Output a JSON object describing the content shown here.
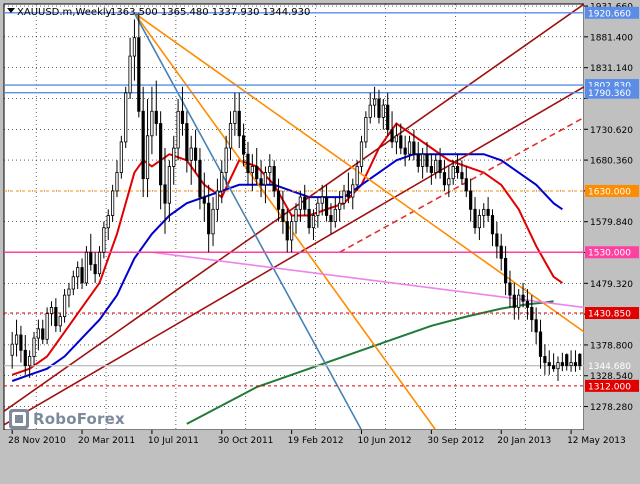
{
  "chart_header": {
    "symbol": "XAUUSD.m,Weekly",
    "ohlc": "1363.500 1365.480 1337.930 1344.930"
  },
  "brand": {
    "name": "RoboForex"
  },
  "colors": {
    "plot_bg": "#ffffff",
    "frame_bg": "#c0c0c0",
    "grid": "#000000",
    "candle": "#000000",
    "ma_short": "#e00000",
    "ma_mid": "#0000d0",
    "ma_long": "#227a3a",
    "level_blue": "#5b8de8",
    "level_pink": "#ff40a0",
    "level_red": "#e00000",
    "level_orange": "#ff8c00",
    "trend_darkred": "#a01010",
    "trend_orange": "#ff8c00",
    "trend_steel": "#4682b4",
    "trend_violet": "#ee82ee"
  },
  "chart_data": {
    "type": "candlestick",
    "timeframe": "Weekly",
    "ylim": [
      1240,
      1935
    ],
    "y_ticks": [
      1931.66,
      1881.4,
      1831.14,
      1780.88,
      1730.62,
      1680.36,
      1630.1,
      1579.84,
      1529.58,
      1479.32,
      1429.06,
      1378.8,
      1328.54,
      1278.28
    ],
    "y_tick_labels": [
      "1931.660",
      "1881.400",
      "1831.140",
      "1730.620",
      "1680.360",
      "1579.840",
      "1479.320",
      "1378.800",
      "1328.540",
      "1278.280"
    ],
    "x_labels": [
      "28 Nov 2010",
      "20 Mar 2011",
      "10 Jul 2011",
      "30 Oct 2011",
      "19 Feb 2012",
      "10 Jun 2012",
      "30 Sep 2012",
      "20 Jan 2013",
      "12 May 2013"
    ],
    "x_label_index": [
      0,
      16,
      32,
      48,
      64,
      80,
      96,
      112,
      128
    ],
    "bars": 131,
    "ohlc": [
      [
        1362,
        1400,
        1340,
        1380
      ],
      [
        1380,
        1420,
        1360,
        1395
      ],
      [
        1395,
        1410,
        1350,
        1370
      ],
      [
        1370,
        1395,
        1330,
        1345
      ],
      [
        1345,
        1370,
        1325,
        1360
      ],
      [
        1360,
        1400,
        1345,
        1390
      ],
      [
        1390,
        1420,
        1370,
        1405
      ],
      [
        1405,
        1420,
        1380,
        1388
      ],
      [
        1388,
        1440,
        1380,
        1430
      ],
      [
        1430,
        1450,
        1410,
        1440
      ],
      [
        1440,
        1455,
        1400,
        1410
      ],
      [
        1410,
        1430,
        1400,
        1425
      ],
      [
        1425,
        1470,
        1415,
        1460
      ],
      [
        1460,
        1480,
        1440,
        1470
      ],
      [
        1470,
        1500,
        1460,
        1490
      ],
      [
        1490,
        1515,
        1470,
        1505
      ],
      [
        1505,
        1520,
        1470,
        1480
      ],
      [
        1480,
        1540,
        1475,
        1530
      ],
      [
        1530,
        1560,
        1500,
        1510
      ],
      [
        1510,
        1530,
        1480,
        1495
      ],
      [
        1495,
        1540,
        1490,
        1530
      ],
      [
        1530,
        1580,
        1520,
        1570
      ],
      [
        1570,
        1600,
        1550,
        1590
      ],
      [
        1590,
        1640,
        1580,
        1630
      ],
      [
        1630,
        1680,
        1620,
        1660
      ],
      [
        1660,
        1720,
        1650,
        1710
      ],
      [
        1710,
        1800,
        1700,
        1790
      ],
      [
        1790,
        1880,
        1780,
        1850
      ],
      [
        1850,
        1910,
        1810,
        1880
      ],
      [
        1880,
        1920,
        1750,
        1760
      ],
      [
        1760,
        1800,
        1620,
        1650
      ],
      [
        1650,
        1780,
        1620,
        1720
      ],
      [
        1720,
        1800,
        1690,
        1760
      ],
      [
        1760,
        1810,
        1720,
        1740
      ],
      [
        1740,
        1760,
        1600,
        1640
      ],
      [
        1640,
        1700,
        1560,
        1610
      ],
      [
        1610,
        1680,
        1580,
        1670
      ],
      [
        1670,
        1720,
        1640,
        1700
      ],
      [
        1700,
        1780,
        1680,
        1760
      ],
      [
        1760,
        1800,
        1720,
        1740
      ],
      [
        1740,
        1760,
        1660,
        1680
      ],
      [
        1680,
        1720,
        1640,
        1700
      ],
      [
        1700,
        1730,
        1660,
        1680
      ],
      [
        1680,
        1700,
        1600,
        1620
      ],
      [
        1620,
        1660,
        1580,
        1610
      ],
      [
        1610,
        1640,
        1530,
        1560
      ],
      [
        1560,
        1620,
        1540,
        1600
      ],
      [
        1600,
        1650,
        1580,
        1630
      ],
      [
        1630,
        1680,
        1610,
        1660
      ],
      [
        1660,
        1720,
        1640,
        1700
      ],
      [
        1700,
        1760,
        1680,
        1740
      ],
      [
        1740,
        1790,
        1720,
        1760
      ],
      [
        1760,
        1790,
        1700,
        1720
      ],
      [
        1720,
        1740,
        1670,
        1690
      ],
      [
        1690,
        1710,
        1640,
        1660
      ],
      [
        1660,
        1690,
        1630,
        1670
      ],
      [
        1670,
        1700,
        1640,
        1650
      ],
      [
        1650,
        1680,
        1620,
        1640
      ],
      [
        1640,
        1670,
        1610,
        1660
      ],
      [
        1660,
        1690,
        1640,
        1670
      ],
      [
        1670,
        1680,
        1620,
        1630
      ],
      [
        1630,
        1650,
        1580,
        1600
      ],
      [
        1600,
        1630,
        1560,
        1580
      ],
      [
        1580,
        1600,
        1530,
        1550
      ],
      [
        1550,
        1590,
        1530,
        1580
      ],
      [
        1580,
        1610,
        1560,
        1600
      ],
      [
        1600,
        1630,
        1580,
        1620
      ],
      [
        1620,
        1640,
        1590,
        1600
      ],
      [
        1600,
        1620,
        1560,
        1570
      ],
      [
        1570,
        1600,
        1550,
        1590
      ],
      [
        1590,
        1620,
        1570,
        1610
      ],
      [
        1610,
        1640,
        1590,
        1620
      ],
      [
        1620,
        1640,
        1580,
        1590
      ],
      [
        1590,
        1610,
        1560,
        1580
      ],
      [
        1580,
        1620,
        1570,
        1600
      ],
      [
        1600,
        1630,
        1580,
        1610
      ],
      [
        1610,
        1640,
        1600,
        1630
      ],
      [
        1630,
        1660,
        1610,
        1620
      ],
      [
        1620,
        1650,
        1600,
        1640
      ],
      [
        1640,
        1680,
        1630,
        1670
      ],
      [
        1670,
        1720,
        1660,
        1710
      ],
      [
        1710,
        1760,
        1700,
        1750
      ],
      [
        1750,
        1790,
        1740,
        1770
      ],
      [
        1770,
        1800,
        1750,
        1780
      ],
      [
        1780,
        1795,
        1740,
        1750
      ],
      [
        1750,
        1780,
        1730,
        1770
      ],
      [
        1770,
        1790,
        1720,
        1730
      ],
      [
        1730,
        1760,
        1700,
        1710
      ],
      [
        1710,
        1740,
        1690,
        1720
      ],
      [
        1720,
        1740,
        1690,
        1700
      ],
      [
        1700,
        1720,
        1670,
        1690
      ],
      [
        1690,
        1720,
        1680,
        1710
      ],
      [
        1710,
        1730,
        1680,
        1690
      ],
      [
        1690,
        1710,
        1660,
        1670
      ],
      [
        1670,
        1700,
        1650,
        1690
      ],
      [
        1690,
        1710,
        1660,
        1670
      ],
      [
        1670,
        1690,
        1640,
        1660
      ],
      [
        1660,
        1690,
        1650,
        1680
      ],
      [
        1680,
        1700,
        1650,
        1660
      ],
      [
        1660,
        1680,
        1630,
        1640
      ],
      [
        1640,
        1670,
        1620,
        1650
      ],
      [
        1650,
        1680,
        1640,
        1670
      ],
      [
        1670,
        1690,
        1650,
        1660
      ],
      [
        1660,
        1680,
        1640,
        1650
      ],
      [
        1650,
        1670,
        1620,
        1630
      ],
      [
        1630,
        1650,
        1580,
        1600
      ],
      [
        1600,
        1620,
        1560,
        1570
      ],
      [
        1570,
        1600,
        1550,
        1590
      ],
      [
        1590,
        1610,
        1570,
        1600
      ],
      [
        1600,
        1620,
        1580,
        1590
      ],
      [
        1590,
        1600,
        1540,
        1560
      ],
      [
        1560,
        1580,
        1520,
        1540
      ],
      [
        1540,
        1560,
        1500,
        1520
      ],
      [
        1520,
        1540,
        1460,
        1480
      ],
      [
        1480,
        1500,
        1440,
        1460
      ],
      [
        1460,
        1480,
        1420,
        1440
      ],
      [
        1440,
        1470,
        1420,
        1460
      ],
      [
        1460,
        1480,
        1440,
        1450
      ],
      [
        1450,
        1470,
        1420,
        1440
      ],
      [
        1440,
        1460,
        1400,
        1420
      ],
      [
        1420,
        1440,
        1380,
        1400
      ],
      [
        1400,
        1420,
        1340,
        1360
      ],
      [
        1360,
        1380,
        1330,
        1350
      ],
      [
        1350,
        1370,
        1330,
        1345
      ],
      [
        1345,
        1365,
        1335,
        1340
      ],
      [
        1340,
        1360,
        1320,
        1350
      ],
      [
        1350,
        1366,
        1336,
        1345
      ],
      [
        1363,
        1365,
        1337,
        1345
      ],
      [
        1345,
        1370,
        1335,
        1350
      ],
      [
        1350,
        1370,
        1335,
        1345
      ],
      [
        1363.5,
        1365.48,
        1337.93,
        1344.93
      ]
    ],
    "moving_averages": [
      {
        "color": "#e00000",
        "points": [
          [
            0,
            1330
          ],
          [
            4,
            1340
          ],
          [
            8,
            1360
          ],
          [
            12,
            1400
          ],
          [
            16,
            1440
          ],
          [
            20,
            1480
          ],
          [
            24,
            1560
          ],
          [
            28,
            1660
          ],
          [
            30,
            1680
          ],
          [
            32,
            1670
          ],
          [
            36,
            1690
          ],
          [
            40,
            1680
          ],
          [
            44,
            1640
          ],
          [
            48,
            1620
          ],
          [
            52,
            1680
          ],
          [
            56,
            1670
          ],
          [
            60,
            1640
          ],
          [
            64,
            1590
          ],
          [
            68,
            1590
          ],
          [
            72,
            1600
          ],
          [
            76,
            1610
          ],
          [
            80,
            1640
          ],
          [
            84,
            1700
          ],
          [
            88,
            1740
          ],
          [
            92,
            1720
          ],
          [
            96,
            1700
          ],
          [
            100,
            1680
          ],
          [
            104,
            1670
          ],
          [
            108,
            1660
          ],
          [
            112,
            1640
          ],
          [
            116,
            1600
          ],
          [
            120,
            1540
          ],
          [
            124,
            1490
          ],
          [
            126,
            1480
          ]
        ]
      },
      {
        "color": "#0000d0",
        "points": [
          [
            0,
            1320
          ],
          [
            4,
            1330
          ],
          [
            8,
            1340
          ],
          [
            12,
            1360
          ],
          [
            16,
            1390
          ],
          [
            20,
            1420
          ],
          [
            24,
            1460
          ],
          [
            28,
            1520
          ],
          [
            32,
            1560
          ],
          [
            36,
            1590
          ],
          [
            40,
            1610
          ],
          [
            44,
            1620
          ],
          [
            48,
            1630
          ],
          [
            52,
            1640
          ],
          [
            56,
            1640
          ],
          [
            60,
            1640
          ],
          [
            64,
            1630
          ],
          [
            68,
            1620
          ],
          [
            72,
            1620
          ],
          [
            76,
            1620
          ],
          [
            80,
            1640
          ],
          [
            84,
            1660
          ],
          [
            88,
            1680
          ],
          [
            92,
            1690
          ],
          [
            96,
            1690
          ],
          [
            100,
            1690
          ],
          [
            104,
            1690
          ],
          [
            108,
            1690
          ],
          [
            112,
            1680
          ],
          [
            116,
            1660
          ],
          [
            120,
            1640
          ],
          [
            124,
            1610
          ],
          [
            126,
            1600
          ]
        ]
      },
      {
        "color": "#227a3a",
        "points": [
          [
            40,
            1250
          ],
          [
            48,
            1280
          ],
          [
            56,
            1310
          ],
          [
            64,
            1330
          ],
          [
            72,
            1350
          ],
          [
            80,
            1370
          ],
          [
            88,
            1390
          ],
          [
            96,
            1410
          ],
          [
            104,
            1425
          ],
          [
            112,
            1438
          ],
          [
            118,
            1445
          ],
          [
            122,
            1448
          ],
          [
            124,
            1450
          ]
        ]
      }
    ],
    "levels": [
      {
        "value": 1920.66,
        "label": "1920.660",
        "color": "#5b8de8",
        "style": "solid"
      },
      {
        "value": 1802.83,
        "label": "1802.830",
        "color": "#5b8de8",
        "style": "solid"
      },
      {
        "value": 1790.36,
        "label": "1790.360",
        "color": "#5b8de8",
        "style": "solid"
      },
      {
        "value": 1630.0,
        "label": "1630.000",
        "color": "#ff8c00",
        "style": "dashed"
      },
      {
        "value": 1530.0,
        "label": "1530.000",
        "color": "#ff40a0",
        "style": "solid"
      },
      {
        "value": 1430.85,
        "label": "1430.850",
        "color": "#e00000",
        "style": "dashed"
      },
      {
        "value": 1344.93,
        "label": "1344.680",
        "color": "#c0c0c0",
        "style": "solid"
      },
      {
        "value": 1312.0,
        "label": "1312.000",
        "color": "#e00000",
        "style": "dashed"
      }
    ],
    "trendlines": [
      {
        "color": "#a01010",
        "style": "solid",
        "points": [
          [
            -2,
            1270
          ],
          [
            131,
            1935
          ]
        ]
      },
      {
        "color": "#a01010",
        "style": "solid",
        "points": [
          [
            -2,
            1248
          ],
          [
            131,
            1800
          ]
        ]
      },
      {
        "color": "#e03030",
        "style": "dashed",
        "points": [
          [
            75,
            1530
          ],
          [
            131,
            1750
          ]
        ]
      },
      {
        "color": "#ff8c00",
        "style": "solid",
        "points": [
          [
            28,
            1920
          ],
          [
            131,
            1400
          ]
        ]
      },
      {
        "color": "#ff8c00",
        "style": "solid",
        "points": [
          [
            28,
            1920
          ],
          [
            97,
            1240
          ]
        ]
      },
      {
        "color": "#4682b4",
        "style": "solid",
        "points": [
          [
            28,
            1920
          ],
          [
            80,
            1240
          ]
        ]
      },
      {
        "color": "#ee82ee",
        "style": "solid",
        "points": [
          [
            32,
            1530
          ],
          [
            131,
            1440
          ]
        ]
      }
    ],
    "grid": true,
    "legend": "none"
  }
}
